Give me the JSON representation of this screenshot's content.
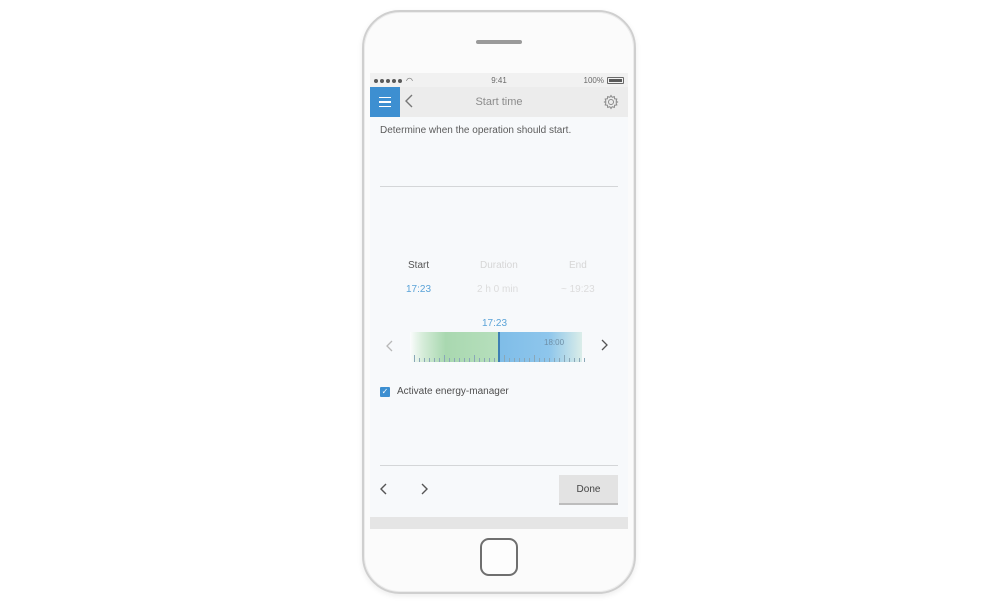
{
  "status_bar": {
    "time": "9:41",
    "battery": "100%"
  },
  "nav": {
    "title": "Start time"
  },
  "description": "Determine when the operation should start.",
  "columns": [
    {
      "label": "Start",
      "value": "17:23",
      "label_color": "#555555",
      "value_color": "#5ba3d8"
    },
    {
      "label": "Duration",
      "value": "2 h 0 min",
      "label_color": "#d6d6d6",
      "value_color": "#dcdcdc"
    },
    {
      "label": "End",
      "value": "~ 19:23",
      "label_color": "#d6d6d6",
      "value_color": "#dcdcdc"
    }
  ],
  "slider": {
    "selected_time": "17:23",
    "tick_label": "18:00"
  },
  "energy_manager": {
    "label": "Activate energy-manager",
    "checked": true
  },
  "footer": {
    "done_label": "Done"
  },
  "colors": {
    "accent": "#3d8fd1"
  }
}
